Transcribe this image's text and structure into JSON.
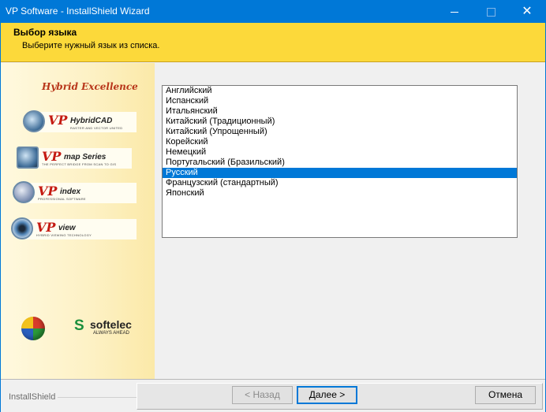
{
  "window": {
    "title": "VP Software - InstallShield Wizard",
    "minimize_glyph": "",
    "maximize_glyph": "",
    "close_glyph": "✕"
  },
  "banner": {
    "heading": "Выбор языка",
    "instruction": "Выберите нужный язык из списка."
  },
  "sidebar": {
    "hybrid": "Hybrid Excellence",
    "products": [
      {
        "vp": "VP",
        "name": "HybridCAD",
        "tag": "RASTER AND VECTOR UNITED"
      },
      {
        "vp": "VP",
        "name": "map Series",
        "tag": "THE PERFECT BRIDGE FROM SCAN TO GIS"
      },
      {
        "vp": "VP",
        "name": "index",
        "tag": "PROFESSIONAL SOFTWARE"
      },
      {
        "vp": "VP",
        "name": "view",
        "tag": "HYBRID VIEWING TECHNOLOGY"
      }
    ],
    "softelec": {
      "mark": "S",
      "word": "softelec",
      "claim": "ALWAYS AHEAD"
    }
  },
  "languages": {
    "items": [
      "Английский",
      "Испанский",
      "Итальянский",
      "Китайский (Традиционный)",
      "Китайский (Упрощенный)",
      "Корейский",
      "Немецкий",
      "Португальский (Бразильский)",
      "Русский",
      "Французский (стандартный)",
      "Японский"
    ],
    "selected": "Русский"
  },
  "footer": {
    "brand": "InstallShield",
    "back_label": "< Назад",
    "next_label": "Далее >",
    "cancel_label": "Отмена"
  },
  "colors": {
    "titlebar": "#0078d7",
    "banner": "#fcd93a",
    "selection": "#0078d7",
    "vp_red": "#c41a12"
  },
  "icons": [
    "minimize-icon",
    "maximize-icon",
    "close-icon",
    "globe-logo-icon",
    "softelec-logo-icon"
  ]
}
